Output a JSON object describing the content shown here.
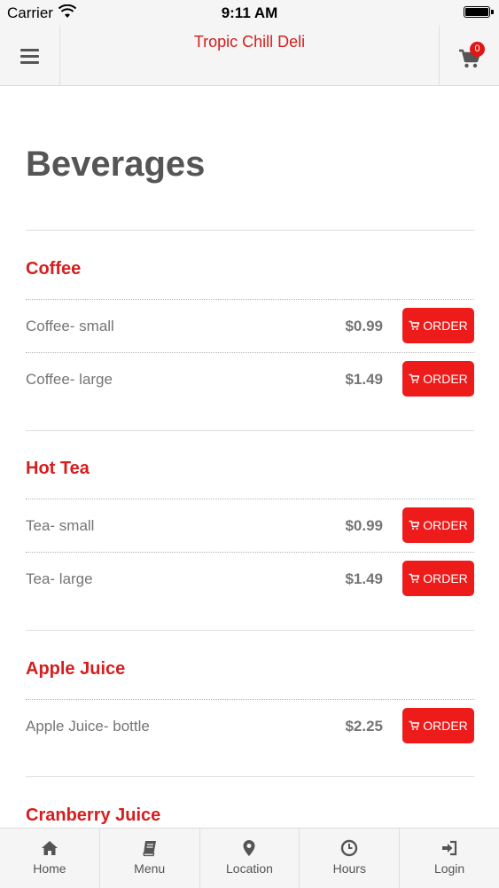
{
  "status_bar": {
    "carrier": "Carrier",
    "time": "9:11 AM"
  },
  "header": {
    "title": "Tropic Chill Deli",
    "cart_count": "0"
  },
  "page": {
    "title": "Beverages",
    "order_label": "ORDER",
    "categories": [
      {
        "name": "Coffee",
        "items": [
          {
            "name": "Coffee- small",
            "price": "$0.99"
          },
          {
            "name": "Coffee- large",
            "price": "$1.49"
          }
        ]
      },
      {
        "name": "Hot Tea",
        "items": [
          {
            "name": "Tea- small",
            "price": "$0.99"
          },
          {
            "name": "Tea- large",
            "price": "$1.49"
          }
        ]
      },
      {
        "name": "Apple Juice",
        "items": [
          {
            "name": "Apple Juice- bottle",
            "price": "$2.25"
          }
        ]
      },
      {
        "name": "Cranberry Juice",
        "items": []
      }
    ]
  },
  "tab_bar": {
    "tabs": [
      {
        "label": "Home",
        "icon": "home-icon"
      },
      {
        "label": "Menu",
        "icon": "book-icon"
      },
      {
        "label": "Location",
        "icon": "map-pin-icon"
      },
      {
        "label": "Hours",
        "icon": "clock-icon"
      },
      {
        "label": "Login",
        "icon": "login-icon"
      }
    ]
  },
  "colors": {
    "brand_red": "#d71d1d",
    "button_red": "#ee1b1b"
  }
}
